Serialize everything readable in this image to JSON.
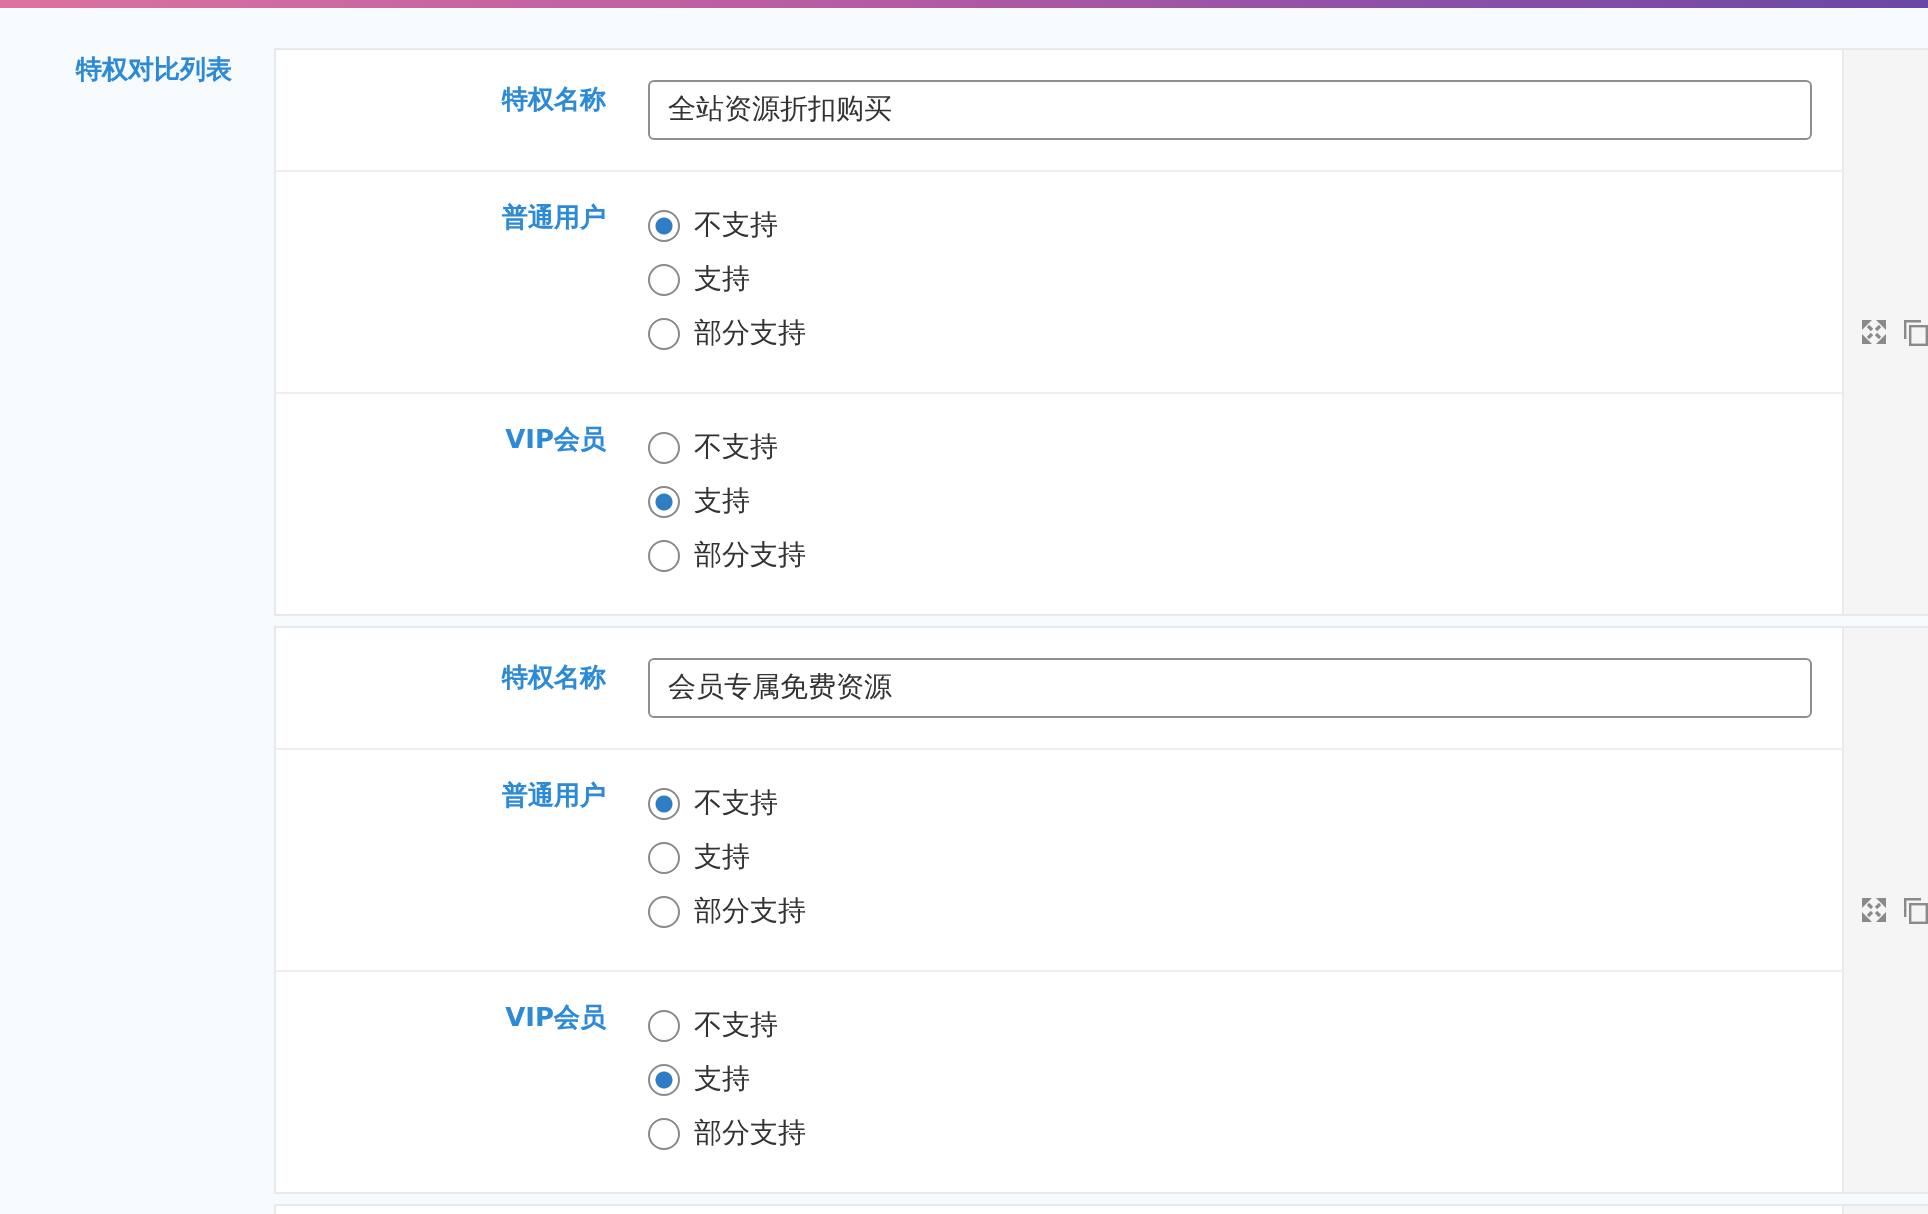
{
  "section_label": "特权对比列表",
  "groups": [
    {
      "fields": [
        {
          "kind": "text",
          "label": "特权名称",
          "value": "全站资源折扣购买"
        },
        {
          "kind": "radio",
          "label": "普通用户",
          "options": [
            {
              "label": "不支持",
              "selected": true
            },
            {
              "label": "支持",
              "selected": false
            },
            {
              "label": "部分支持",
              "selected": false
            }
          ]
        },
        {
          "kind": "radio",
          "label": "VIP会员",
          "options": [
            {
              "label": "不支持",
              "selected": false
            },
            {
              "label": "支持",
              "selected": true
            },
            {
              "label": "部分支持",
              "selected": false
            }
          ]
        }
      ]
    },
    {
      "fields": [
        {
          "kind": "text",
          "label": "特权名称",
          "value": "会员专属免费资源"
        },
        {
          "kind": "radio",
          "label": "普通用户",
          "options": [
            {
              "label": "不支持",
              "selected": true
            },
            {
              "label": "支持",
              "selected": false
            },
            {
              "label": "部分支持",
              "selected": false
            }
          ]
        },
        {
          "kind": "radio",
          "label": "VIP会员",
          "options": [
            {
              "label": "不支持",
              "selected": false
            },
            {
              "label": "支持",
              "selected": true
            },
            {
              "label": "部分支持",
              "selected": false
            }
          ]
        }
      ]
    }
  ]
}
